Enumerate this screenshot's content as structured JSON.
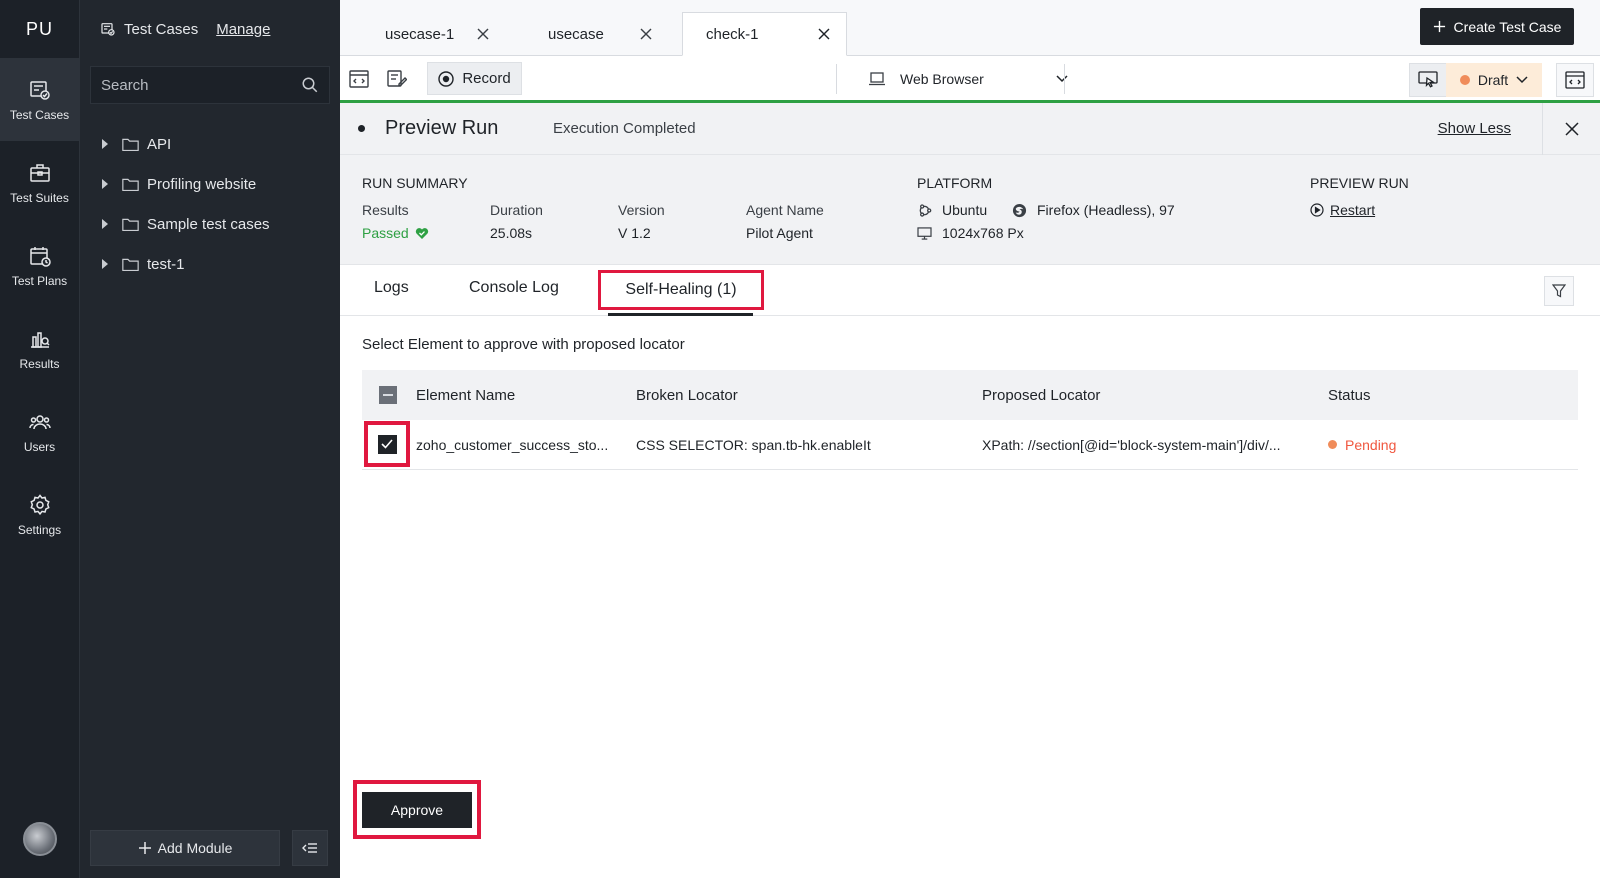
{
  "app": {
    "initials": "PU"
  },
  "rail": {
    "items": [
      {
        "label": "Test Cases",
        "icon": "test-cases-icon"
      },
      {
        "label": "Test Suites",
        "icon": "briefcase-icon"
      },
      {
        "label": "Test Plans",
        "icon": "calendar-icon"
      },
      {
        "label": "Results",
        "icon": "results-chart-icon"
      },
      {
        "label": "Users",
        "icon": "users-icon"
      },
      {
        "label": "Settings",
        "icon": "gear-icon"
      }
    ]
  },
  "sidebar": {
    "title": "Test Cases",
    "manage": "Manage",
    "search_placeholder": "Search",
    "modules": [
      "API",
      "Profiling website",
      "Sample test cases",
      "test-1"
    ],
    "add_module": "Add Module"
  },
  "tabs": [
    {
      "label": "usecase-1"
    },
    {
      "label": "usecase"
    },
    {
      "label": "check-1"
    }
  ],
  "header": {
    "create_label": "Create Test Case"
  },
  "toolbar": {
    "record": "Record",
    "browser": "Web Browser",
    "draft": "Draft"
  },
  "preview": {
    "title": "Preview Run",
    "status": "Execution Completed",
    "show_less": "Show Less"
  },
  "summary": {
    "run_summary": "RUN SUMMARY",
    "results_label": "Results",
    "results_value": "Passed",
    "duration_label": "Duration",
    "duration_value": "25.08s",
    "version_label": "Version",
    "version_value": "V 1.2",
    "agent_label": "Agent Name",
    "agent_value": "Pilot Agent",
    "platform_head": "PLATFORM",
    "os": "Ubuntu",
    "browser": "Firefox (Headless), 97",
    "resolution": "1024x768 Px",
    "preview_head": "PREVIEW RUN",
    "restart": "Restart"
  },
  "subtabs": {
    "logs": "Logs",
    "console": "Console Log",
    "self_healing": "Self-Healing (1)"
  },
  "healing": {
    "instruction": "Select Element to approve with proposed locator",
    "columns": [
      "Element Name",
      "Broken Locator",
      "Proposed Locator",
      "Status"
    ],
    "rows": [
      {
        "element": "zoho_customer_success_sto...",
        "broken": "CSS SELECTOR: span.tb-hk.enableIt",
        "proposed": "XPath: //section[@id='block-system-main']/div/...",
        "status": "Pending",
        "checked": true
      }
    ],
    "approve": "Approve"
  },
  "colors": {
    "accent_green": "#2ea043",
    "highlight_red": "#e0183f",
    "pending": "#f0573f",
    "dark": "#1f2328"
  }
}
